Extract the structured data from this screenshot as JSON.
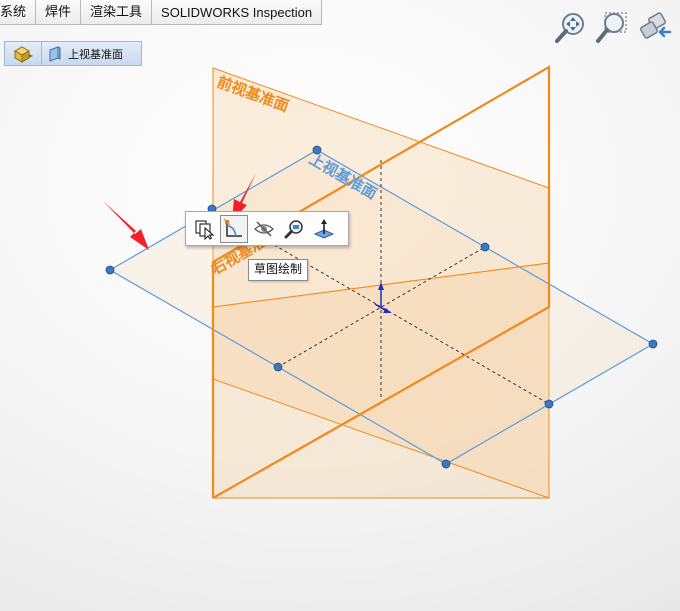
{
  "command_tabs": [
    "系统",
    "焊件",
    "渲染工具",
    "SOLIDWORKS Inspection"
  ],
  "breadcrumb": {
    "part_icon": "part-icon",
    "plane_icon": "plane-icon",
    "label": "上视基准面"
  },
  "view_tools": [
    {
      "name": "zoom-to-fit-icon"
    },
    {
      "name": "zoom-to-area-icon"
    },
    {
      "name": "previous-view-icon"
    }
  ],
  "planes": {
    "front_label": "前视基准面",
    "top_label": "上视基准面",
    "right_label": "右视基准面",
    "front_color": "#f08a1c",
    "top_color": "#5b9bdc",
    "right_color": "#f08a1c"
  },
  "context_toolbar": {
    "items": [
      {
        "name": "select-other-icon"
      },
      {
        "name": "sketch-icon",
        "active": true
      },
      {
        "name": "hide-icon"
      },
      {
        "name": "zoom-to-selection-icon"
      },
      {
        "name": "normal-to-icon"
      }
    ],
    "tooltip": "草图绘制"
  },
  "annotations": {
    "arrow_color": "#f2202a"
  }
}
